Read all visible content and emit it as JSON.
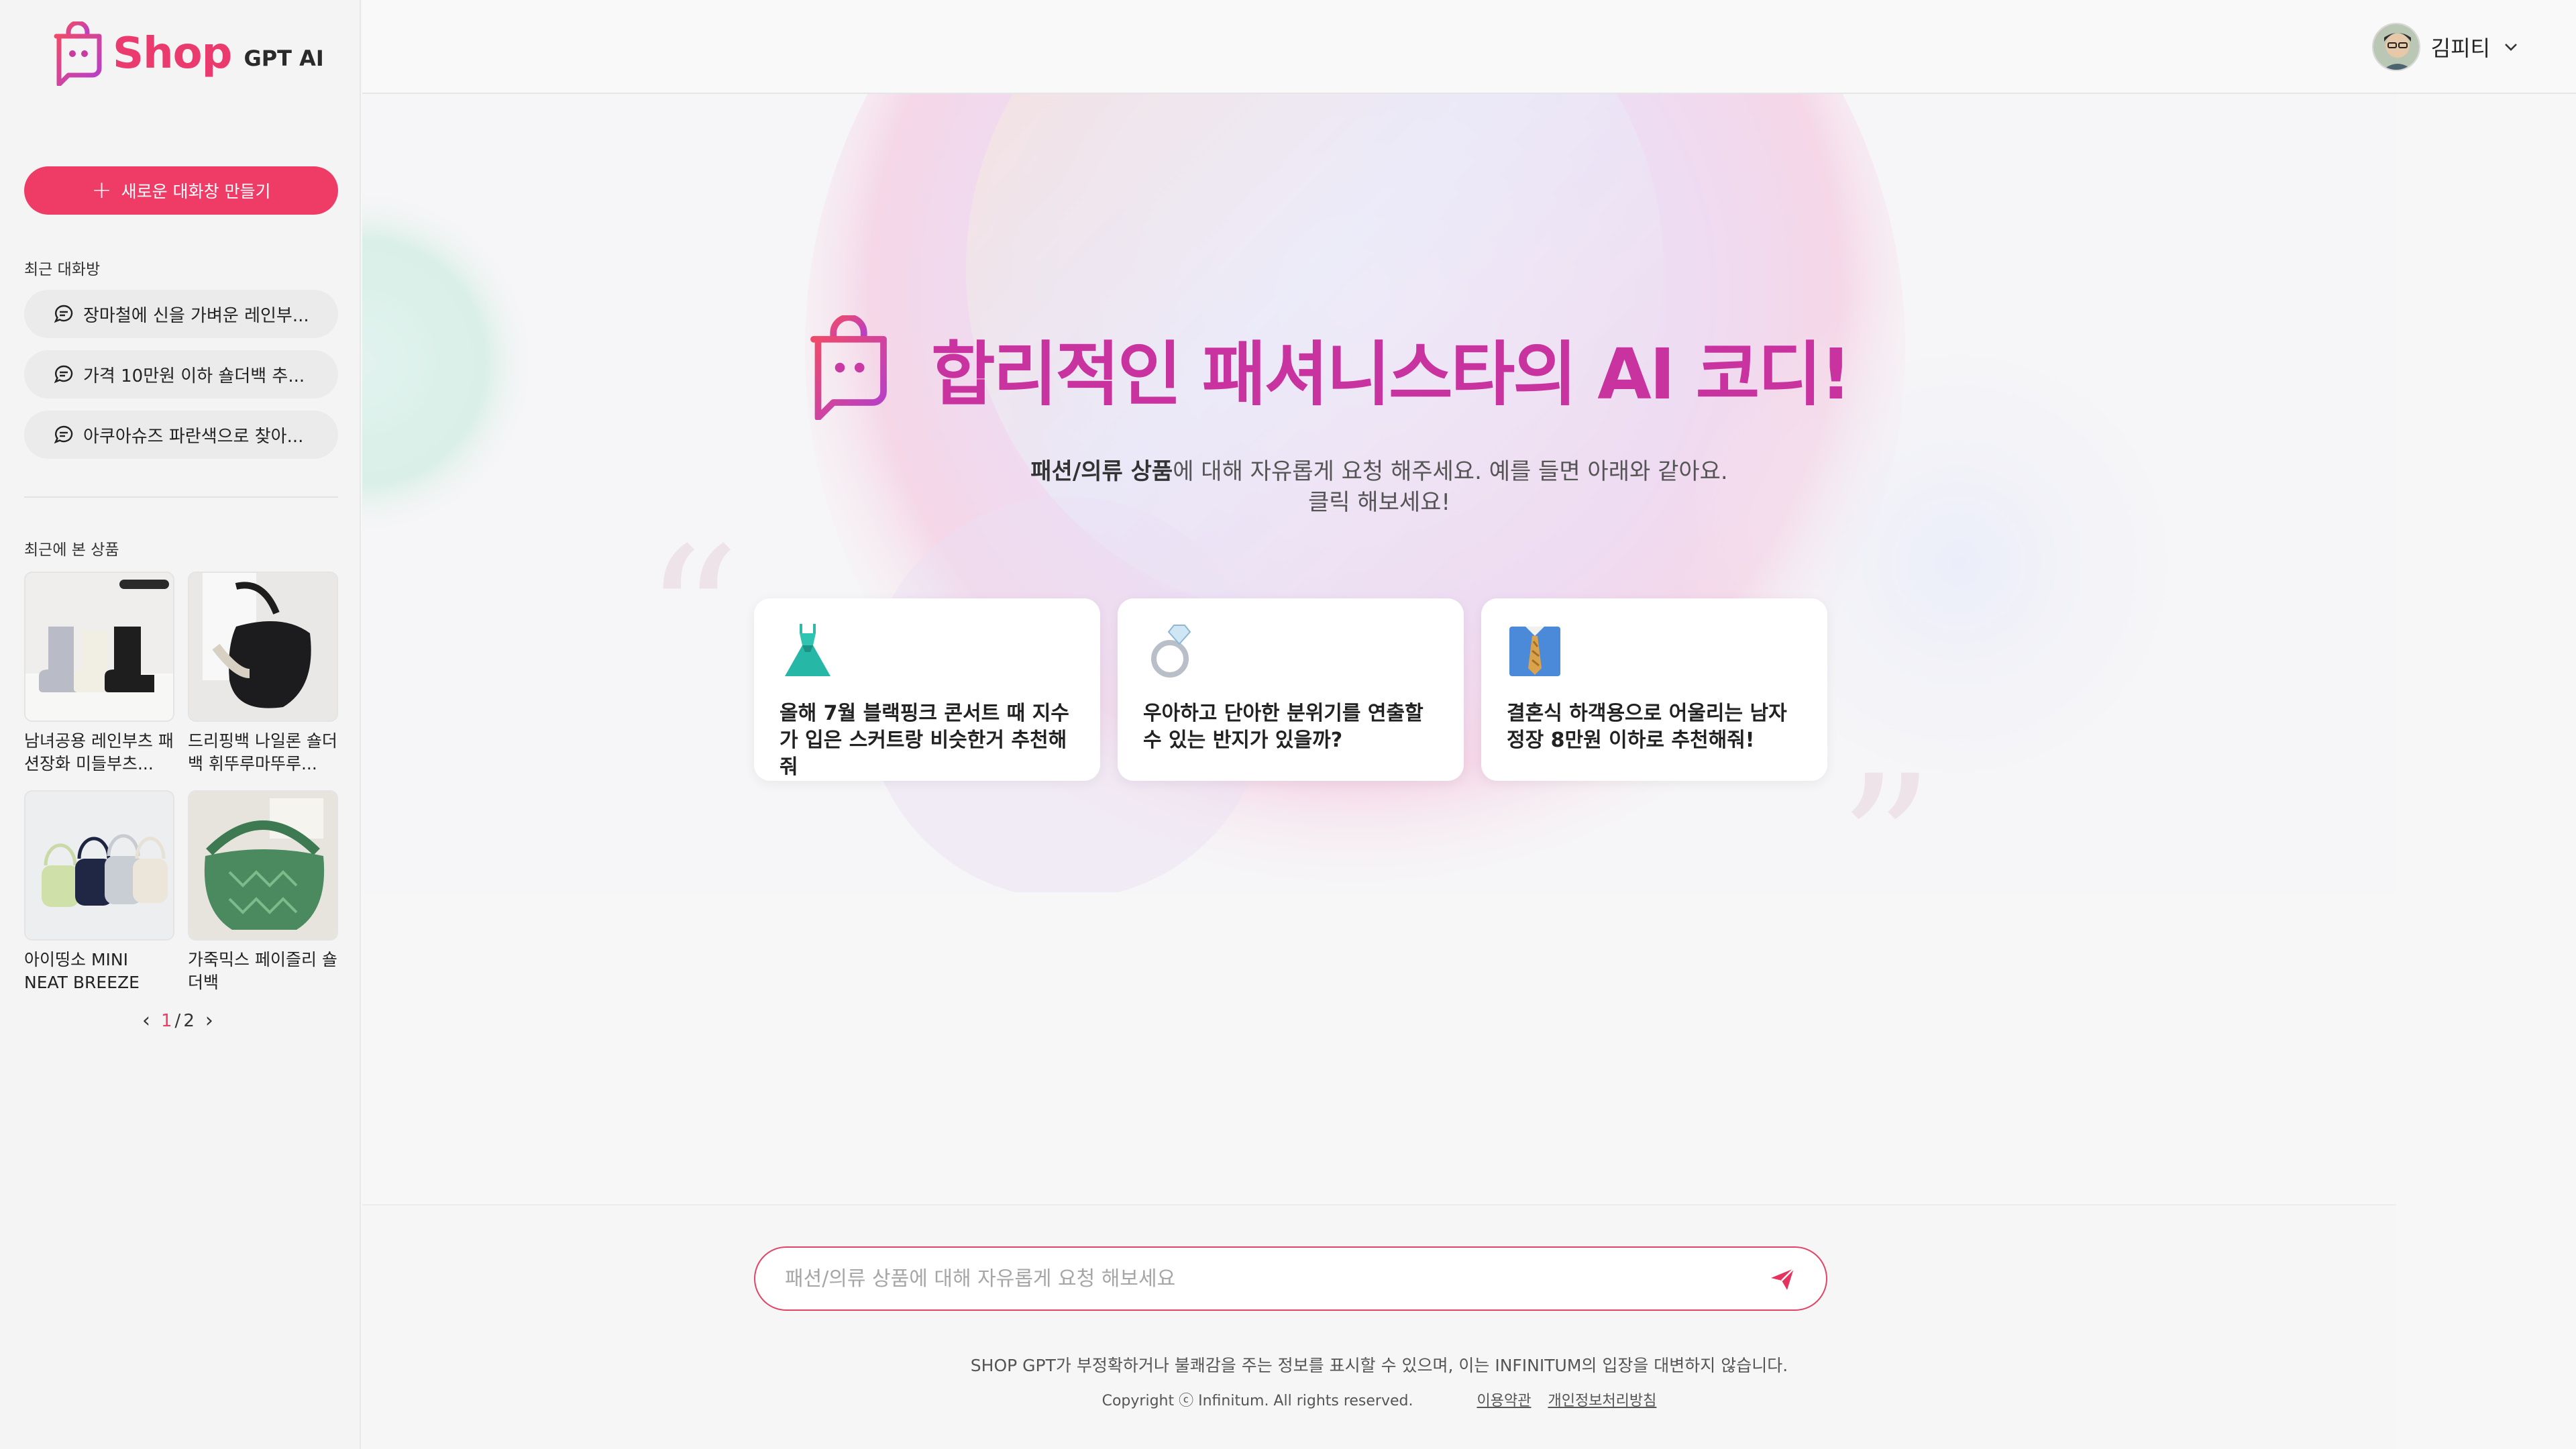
{
  "brand": {
    "logo_text": "Shop",
    "logo_sub": "GPT AI"
  },
  "sidebar": {
    "new_chat_label": "새로운 대화창 만들기",
    "recent_chats_label": "최근 대화방",
    "recent_chats": [
      "장마철에 신을 가벼운 레인부...",
      "가격 10만원 이하 숄더백 추...",
      "아쿠아슈즈 파란색으로 찾아..."
    ],
    "recent_products_label": "최근에 본 상품",
    "products": [
      {
        "name": "남녀공용 레인부츠 패션장화 미들부츠..."
      },
      {
        "name": "드리핑백 나일론 숄더백 휘뚜루마뚜루..."
      },
      {
        "name": "아이띵소 MINI NEAT BREEZE 미..."
      },
      {
        "name": "가죽믹스 페이즐리 숄더백"
      }
    ],
    "pager": {
      "current": "1",
      "separator": "/",
      "total": "2"
    }
  },
  "header": {
    "user_name": "김피티"
  },
  "main": {
    "headline": "합리적인 패셔니스타의 AI 코디!",
    "subtitle_bold": "패션/의류 상품",
    "subtitle_rest": "에 대해 자유롭게 요청 해주세요. 예를 들면 아래와 같아요.",
    "subtitle_line2": "클릭 해보세요!",
    "suggestions": [
      {
        "icon": "dress-icon",
        "text": "올해 7월 블랙핑크 콘서트 때 지수가 입은 스커트랑 비슷한거 추천해줘"
      },
      {
        "icon": "ring-icon",
        "text": "우아하고 단아한 분위기를 연출할 수 있는 반지가 있을까?"
      },
      {
        "icon": "shirt-tie-icon",
        "text": "결혼식 하객용으로 어울리는 남자 정장 8만원 이하로 추천해줘!"
      }
    ]
  },
  "input": {
    "placeholder": "패션/의류 상품에 대해 자유롭게 요청 해보세요"
  },
  "footer": {
    "disclaimer": "SHOP GPT가 부정확하거나 불쾌감을 주는 정보를 표시할 수 있으며, 이는 INFINITUM의 입장을 대변하지 않습니다.",
    "copyright": "Copyright ⓒ Infinitum. All rights reserved.",
    "terms": "이용약관",
    "privacy": "개인정보처리방침"
  },
  "colors": {
    "accent": "#ef3c66",
    "headline": "#c9339f",
    "sidebar_bg": "#f4f4f4"
  }
}
